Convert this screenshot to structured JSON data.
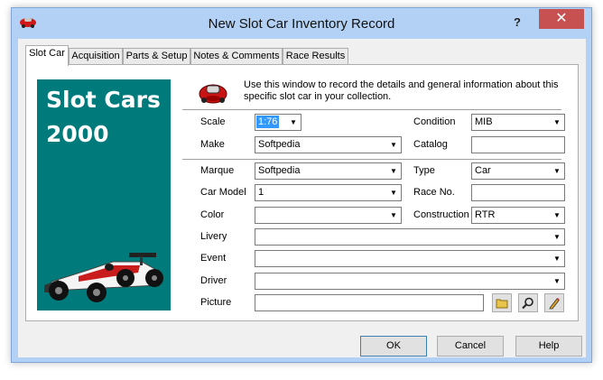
{
  "window": {
    "title": "New Slot Car Inventory Record",
    "help_glyph": "?",
    "close_glyph": "✕"
  },
  "tabs": [
    "Slot Car",
    "Acquisition",
    "Parts & Setup",
    "Notes & Comments",
    "Race Results"
  ],
  "logo": {
    "line1": "Slot Cars",
    "line2": "2000",
    "bg_color": "#007a7a"
  },
  "intro": "Use this window to record the details and general information about this specific slot car in your collection.",
  "form": {
    "scale": {
      "label": "Scale",
      "value": "1:76"
    },
    "make": {
      "label": "Make",
      "value": "Softpedia"
    },
    "condition": {
      "label": "Condition",
      "value": "MIB"
    },
    "catalog": {
      "label": "Catalog",
      "value": ""
    },
    "marque": {
      "label": "Marque",
      "value": "Softpedia"
    },
    "car_model": {
      "label": "Car Model",
      "value": "1"
    },
    "color": {
      "label": "Color",
      "value": ""
    },
    "type": {
      "label": "Type",
      "value": "Car"
    },
    "race_no": {
      "label": "Race No.",
      "value": ""
    },
    "construction": {
      "label": "Construction",
      "value": "RTR"
    },
    "livery": {
      "label": "Livery",
      "value": ""
    },
    "event": {
      "label": "Event",
      "value": ""
    },
    "driver": {
      "label": "Driver",
      "value": ""
    },
    "picture": {
      "label": "Picture",
      "value": ""
    }
  },
  "picture_buttons": {
    "browse_icon": "folder-icon",
    "view_icon": "magnifier-icon",
    "edit_icon": "pencil-icon"
  },
  "buttons": {
    "ok": "OK",
    "cancel": "Cancel",
    "help": "Help"
  }
}
